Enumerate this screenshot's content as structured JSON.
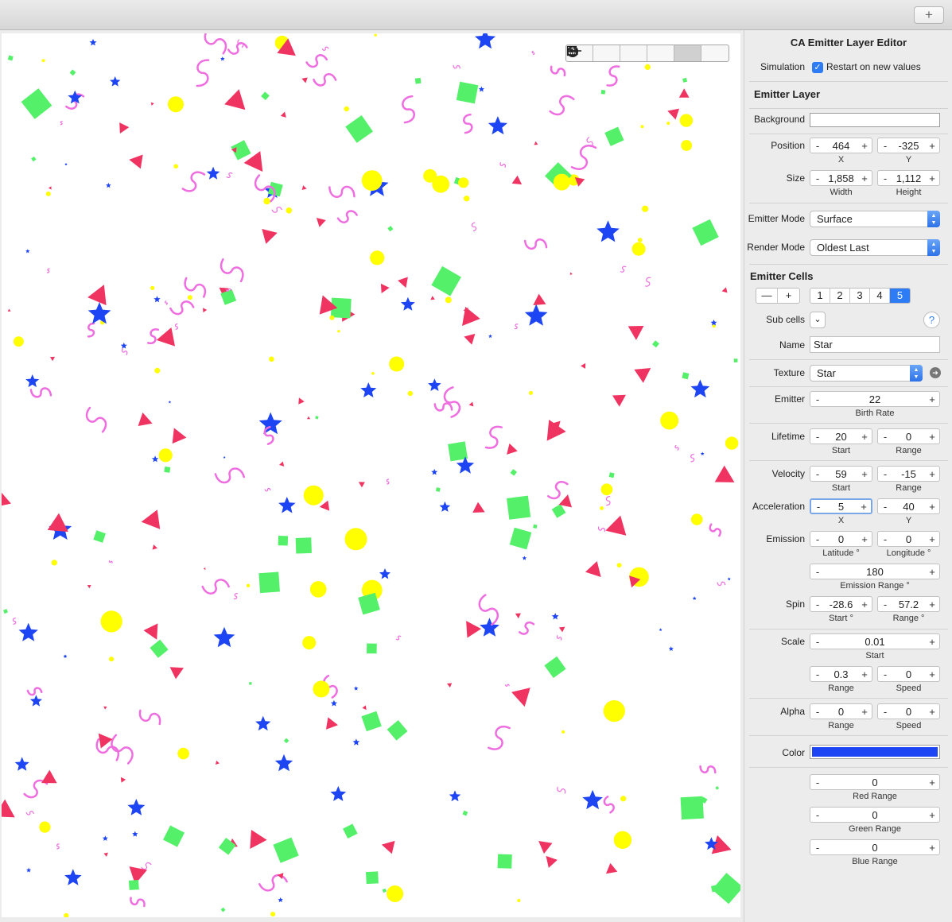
{
  "toolbar": {
    "add_label": "+"
  },
  "shape_buttons": [
    {
      "icon": "point-icon",
      "selected": false
    },
    {
      "icon": "line-icon",
      "selected": false
    },
    {
      "icon": "rectangle-icon",
      "selected": false
    },
    {
      "icon": "cuboid-icon",
      "selected": false
    },
    {
      "icon": "circle-icon",
      "selected": true
    },
    {
      "icon": "sphere-icon",
      "selected": false
    }
  ],
  "editor": {
    "title": "CA Emitter Layer Editor",
    "simulation_label": "Simulation",
    "restart_label": "Restart on new values",
    "restart_checked": true
  },
  "emitter_layer": {
    "heading": "Emitter Layer",
    "background_label": "Background",
    "background_color": "#ffffff",
    "position_label": "Position",
    "position_x": "464",
    "position_y": "-325",
    "x_label": "X",
    "y_label": "Y",
    "size_label": "Size",
    "size_width": "1,858",
    "size_height": "1,112",
    "width_label": "Width",
    "height_label": "Height",
    "emitter_mode_label": "Emitter Mode",
    "emitter_mode_value": "Surface",
    "render_mode_label": "Render Mode",
    "render_mode_value": "Oldest Last"
  },
  "emitter_cells": {
    "heading": "Emitter Cells",
    "remove_label": "—",
    "add_label": "+",
    "cell_tabs": [
      "1",
      "2",
      "3",
      "4",
      "5"
    ],
    "selected_tab": "5",
    "subcells_label": "Sub cells",
    "help_label": "?",
    "name_label": "Name",
    "name_value": "Star",
    "texture_label": "Texture",
    "texture_value": "Star",
    "emitter_label": "Emitter",
    "birth_rate": "22",
    "birth_rate_label": "Birth Rate",
    "lifetime_label": "Lifetime",
    "lifetime_start": "20",
    "lifetime_range": "0",
    "start_label": "Start",
    "range_label": "Range",
    "velocity_label": "Velocity",
    "velocity_start": "59",
    "velocity_range": "-15",
    "acceleration_label": "Acceleration",
    "accel_x": "5",
    "accel_y": "40",
    "emission_label": "Emission",
    "latitude": "0",
    "longitude": "0",
    "latitude_label": "Latitude °",
    "longitude_label": "Longitude °",
    "emission_range": "180",
    "emission_range_label": "Emission Range °",
    "spin_label": "Spin",
    "spin_start": "-28.6",
    "spin_range": "57.2",
    "spin_start_label": "Start °",
    "spin_range_label": "Range °",
    "scale_label": "Scale",
    "scale_start": "0.01",
    "scale_range": "0.3",
    "scale_speed": "0",
    "speed_label": "Speed",
    "alpha_label": "Alpha",
    "alpha_range": "0",
    "alpha_speed": "0",
    "color_label": "Color",
    "color_value": "#1e45f3",
    "red_range": "0",
    "red_range_label": "Red Range",
    "green_range": "0",
    "green_range_label": "Green Range",
    "blue_range": "0",
    "blue_range_label": "Blue Range"
  },
  "stepper_minus": "-",
  "stepper_plus": "+",
  "particle_colors": {
    "circle": "#ffff00",
    "square": "#55f06a",
    "triangle": "#ef3462",
    "star": "#1e45f3",
    "squiggle": "#ee6ee0"
  }
}
